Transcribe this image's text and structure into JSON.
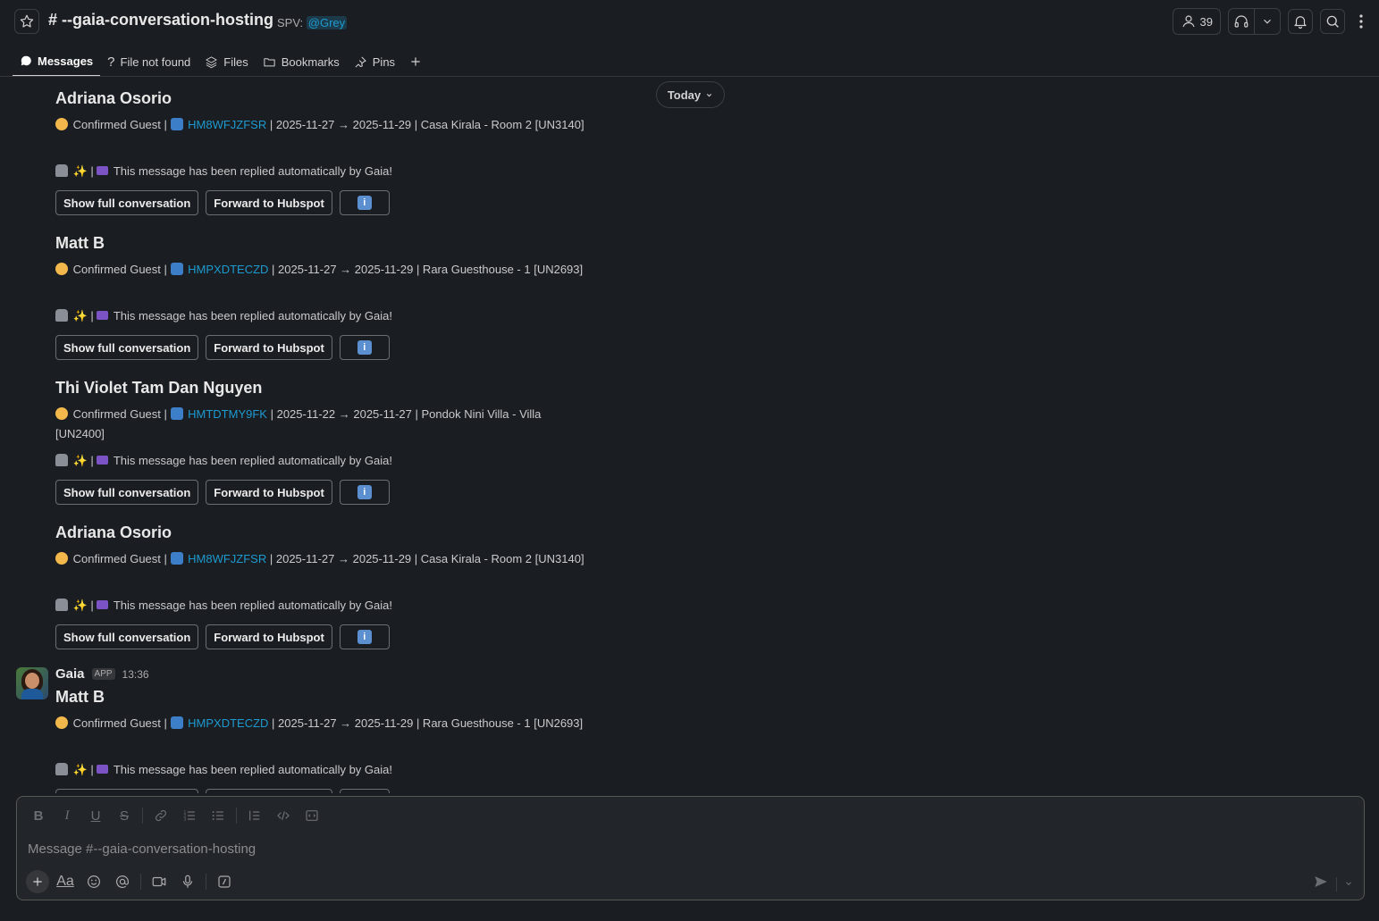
{
  "header": {
    "channel_title": "# --gaia-conversation-hosting",
    "spv_label": "SPV:",
    "spv_mention": "@Grey",
    "member_count": "39"
  },
  "tabs": [
    {
      "label": "Messages",
      "icon": "message-icon"
    },
    {
      "label": "File not found",
      "icon": "question-icon"
    },
    {
      "label": "Files",
      "icon": "files-icon"
    },
    {
      "label": "Bookmarks",
      "icon": "folder-icon"
    },
    {
      "label": "Pins",
      "icon": "pin-icon"
    }
  ],
  "date_divider": "Today",
  "messages": [
    {
      "guest": "Adriana Osorio",
      "status": "Confirmed Guest |",
      "code": "HM8WFJZFSR",
      "details": "| 2025-11-27 → 2025-11-29 | Casa Kirala - Room 2 [UN3140]",
      "auto_reply": "This message has been replied automatically by Gaia!"
    },
    {
      "guest": "Matt B",
      "status": "Confirmed Guest |",
      "code": "HMPXDTECZD",
      "details": "| 2025-11-27 → 2025-11-29 | Rara Guesthouse - 1 [UN2693]",
      "auto_reply": "This message has been replied automatically by Gaia!"
    },
    {
      "guest": "Thi Violet Tam Dan Nguyen",
      "status": "Confirmed Guest |",
      "code": "HMTDTMY9FK",
      "details": "| 2025-11-22 → 2025-11-27 | Pondok Nini Villa - Villa [UN2400]",
      "auto_reply": "This message has been replied automatically by Gaia!"
    },
    {
      "guest": "Adriana Osorio",
      "status": "Confirmed Guest |",
      "code": "HM8WFJZFSR",
      "details": "| 2025-11-27 → 2025-11-29 | Casa Kirala - Room 2 [UN3140]",
      "auto_reply": "This message has been replied automatically by Gaia!"
    },
    {
      "guest": "Matt B",
      "status": "Confirmed Guest |",
      "code": "HMPXDTECZD",
      "details": "| 2025-11-27 → 2025-11-29 | Rara Guesthouse - 1 [UN2693]",
      "auto_reply": "This message has been replied automatically by Gaia!"
    }
  ],
  "buttons": {
    "show_full": "Show full conversation",
    "forward": "Forward to Hubspot",
    "info": "i"
  },
  "sender": {
    "name": "Gaia",
    "badge": "APP",
    "time": "13:36"
  },
  "composer": {
    "placeholder": "Message #--gaia-conversation-hosting",
    "font_button": "Aa"
  },
  "colors": {
    "background": "#1a1d21",
    "link": "#1d9bd1",
    "composer_bg": "#222529"
  }
}
